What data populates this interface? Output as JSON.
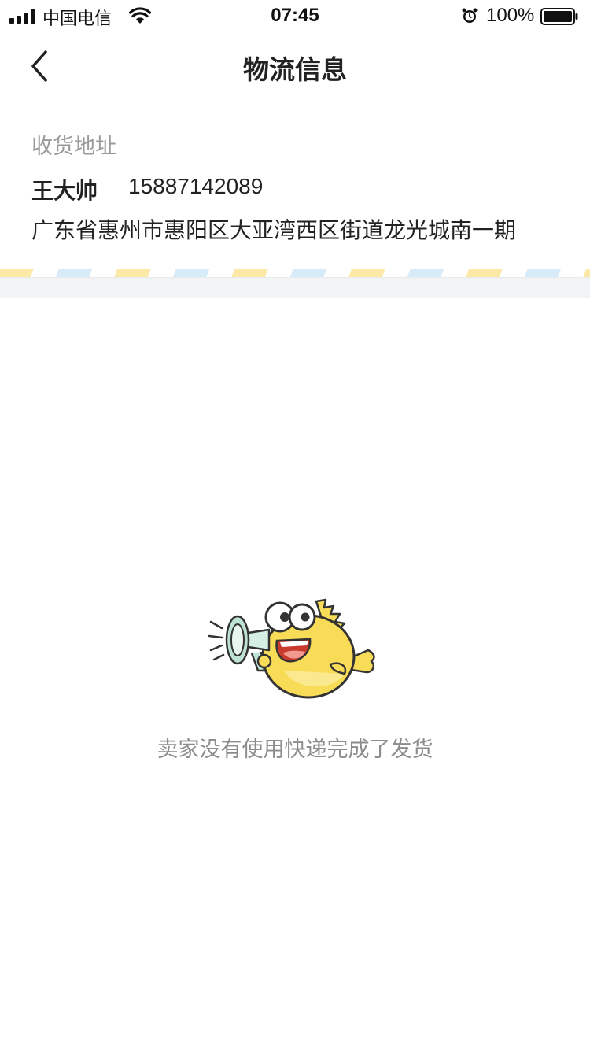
{
  "status_bar": {
    "carrier": "中国电信",
    "time": "07:45",
    "battery_percent": "100%",
    "icons": [
      "signal-icon",
      "wifi-icon",
      "alarm-icon",
      "battery-icon"
    ]
  },
  "nav": {
    "title": "物流信息",
    "back_icon": "chevron-left-icon"
  },
  "address": {
    "label": "收货地址",
    "name": "王大帅",
    "phone": "15887142089",
    "full_address": "广东省惠州市惠阳区大亚湾西区街道龙光城南一期"
  },
  "empty_state": {
    "illustration": "fish-megaphone-illustration",
    "message": "卖家没有使用快递完成了发货"
  },
  "colors": {
    "stripe_yellow": "#fce9a8",
    "stripe_blue": "#d7ebf8",
    "fish_yellow": "#f8dc57",
    "muted_text": "#8c8c8c"
  }
}
